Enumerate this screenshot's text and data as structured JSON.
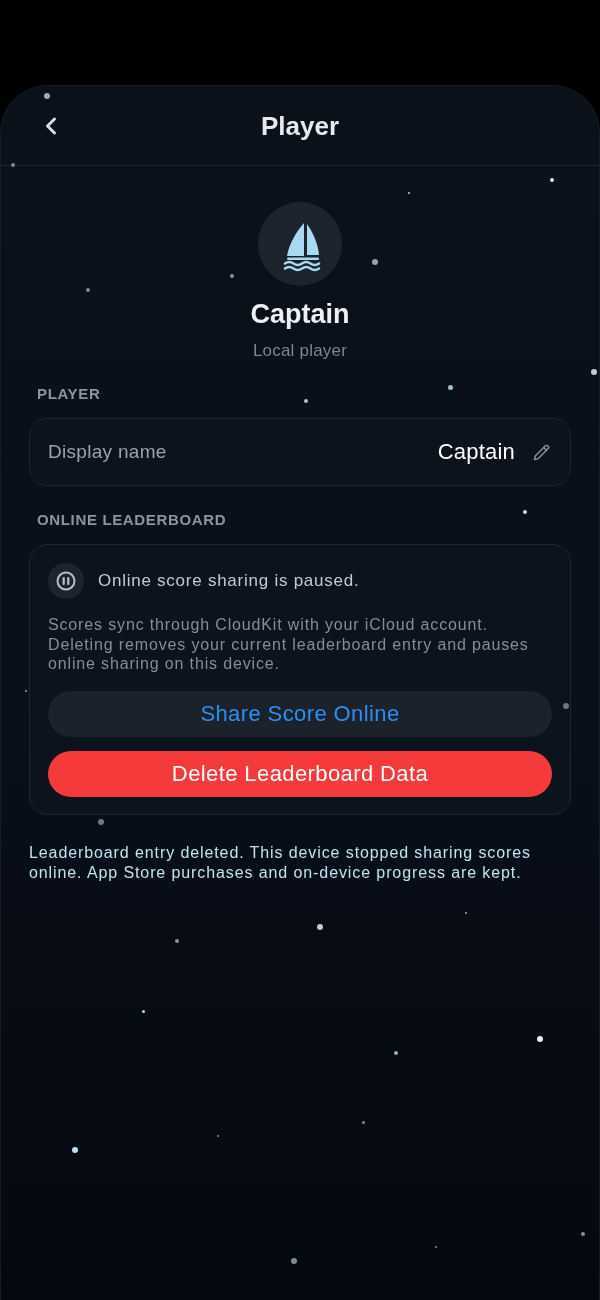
{
  "header": {
    "title": "Player"
  },
  "profile": {
    "name": "Captain",
    "subtitle": "Local player"
  },
  "player_section": {
    "heading": "PLAYER",
    "display_name": {
      "label": "Display name",
      "value": "Captain"
    }
  },
  "leaderboard_section": {
    "heading": "ONLINE LEADERBOARD",
    "status": "Online score sharing is paused.",
    "description": "Scores sync through CloudKit with your iCloud account. Deleting removes your current leaderboard entry and pauses online sharing on this device.",
    "buttons": [
      {
        "label": "Share Score Online",
        "kind": "secondary"
      },
      {
        "label": "Delete Leaderboard Data",
        "kind": "destructive"
      }
    ]
  },
  "notice": "Leaderboard entry deleted. This device stopped sharing scores online. App Store purchases and on-device progress are kept."
}
